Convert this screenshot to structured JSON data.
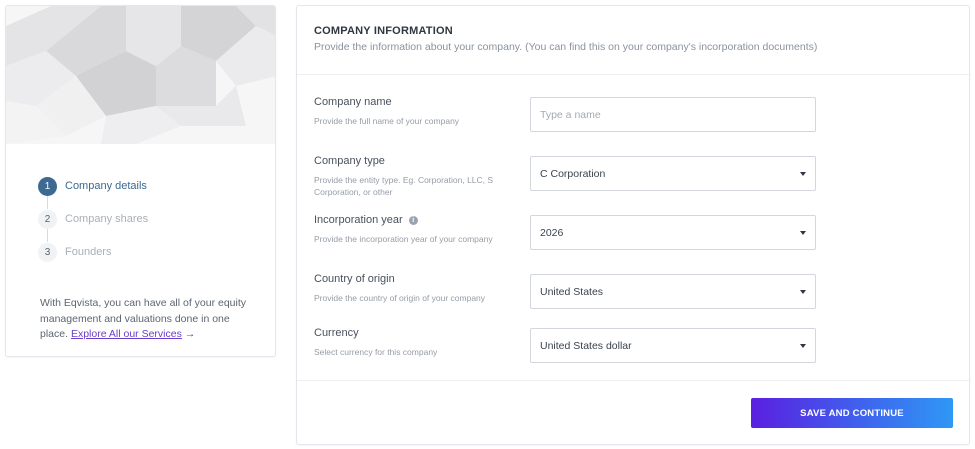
{
  "sidebar": {
    "steps": [
      {
        "number": "1",
        "label": "Company details",
        "state": "active"
      },
      {
        "number": "2",
        "label": "Company shares",
        "state": "idle"
      },
      {
        "number": "3",
        "label": "Founders",
        "state": "idle"
      }
    ],
    "promo_text": "With Eqvista, you can have all of your equity management and valuations done in one place.",
    "promo_link": "Explore All our Services",
    "promo_arrow_icon": "arrow-right-icon"
  },
  "section": {
    "title": "COMPANY INFORMATION",
    "subtitle": "Provide the information about your company. (You can find this on your company's incorporation documents)"
  },
  "fields": {
    "company_name": {
      "label": "Company name",
      "help": "Provide the full name of your company",
      "placeholder": "Type a name",
      "value": ""
    },
    "company_type": {
      "label": "Company type",
      "help": "Provide the entity type. Eg. Corporation, LLC, S Corporation, or other",
      "value": "C Corporation"
    },
    "incorporation_year": {
      "label": "Incorporation year",
      "info_icon": "i",
      "help": "Provide the incorporation year of your company",
      "value": "2026"
    },
    "country": {
      "label": "Country of origin",
      "help": "Provide the country of origin of your company",
      "value": "United States"
    },
    "currency": {
      "label": "Currency",
      "help": "Select currency for this company",
      "value": "United States dollar"
    }
  },
  "actions": {
    "save_label": "SAVE AND CONTINUE"
  },
  "colors": {
    "accent": "#3c6a91",
    "link": "#6a3fc9",
    "button_gradient_start": "#5a1fe0",
    "button_gradient_end": "#2f98f5"
  }
}
